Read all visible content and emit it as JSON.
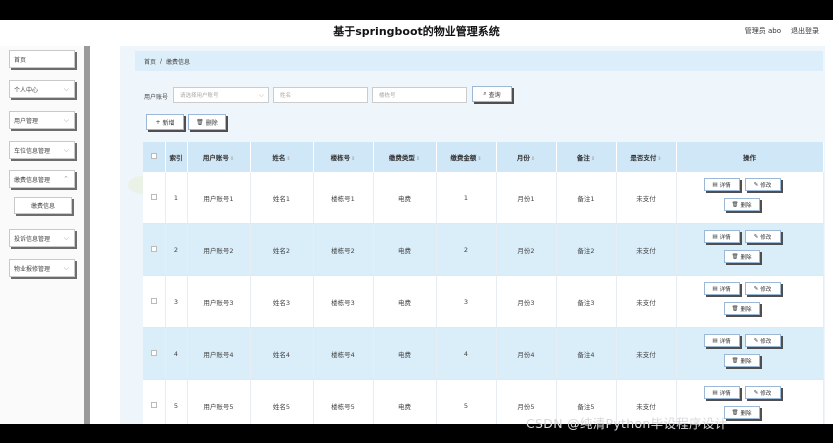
{
  "header": {
    "title": "基于springboot的物业管理系统",
    "user": "管理员 abo",
    "logout": "退出登录"
  },
  "sidebar": {
    "items": [
      {
        "label": "首页",
        "has_chevron": false
      },
      {
        "label": "个人中心",
        "has_chevron": true
      },
      {
        "label": "用户管理",
        "has_chevron": true
      },
      {
        "label": "车位信息管理",
        "has_chevron": true
      },
      {
        "label": "缴费信息管理",
        "has_chevron": true
      },
      {
        "label": "投诉信息管理",
        "has_chevron": true
      },
      {
        "label": "物业报修管理",
        "has_chevron": true
      }
    ],
    "sub_item": "缴费信息"
  },
  "breadcrumb": {
    "home": "首页",
    "sep": "/",
    "current": "缴费信息"
  },
  "search": {
    "label": "用户账号",
    "account_placeholder": "请选择用户账号",
    "name_placeholder": "姓名",
    "building_placeholder": "楼栋号",
    "query_button": "查询"
  },
  "toolbar": {
    "add_label": "新增",
    "delete_label": "删除"
  },
  "table": {
    "headers": [
      "索引",
      "用户账号",
      "姓名",
      "楼栋号",
      "缴费类型",
      "缴费金额",
      "月份",
      "备注",
      "是否支付",
      "操作"
    ],
    "rows": [
      {
        "index": "1",
        "account": "用户账号1",
        "name": "姓名1",
        "building": "楼栋号1",
        "type": "电费",
        "amount": "1",
        "month": "月份1",
        "note": "备注1",
        "paid": "未支付"
      },
      {
        "index": "2",
        "account": "用户账号2",
        "name": "姓名2",
        "building": "楼栋号2",
        "type": "电费",
        "amount": "2",
        "month": "月份2",
        "note": "备注2",
        "paid": "未支付"
      },
      {
        "index": "3",
        "account": "用户账号3",
        "name": "姓名3",
        "building": "楼栋号3",
        "type": "电费",
        "amount": "3",
        "month": "月份3",
        "note": "备注3",
        "paid": "未支付"
      },
      {
        "index": "4",
        "account": "用户账号4",
        "name": "姓名4",
        "building": "楼栋号4",
        "type": "电费",
        "amount": "4",
        "month": "月份4",
        "note": "备注4",
        "paid": "未支付"
      },
      {
        "index": "5",
        "account": "用户账号5",
        "name": "姓名5",
        "building": "楼栋号5",
        "type": "电费",
        "amount": "5",
        "month": "月份5",
        "note": "备注5",
        "paid": "未支付"
      }
    ],
    "ops": {
      "detail": "详情",
      "edit": "修改",
      "delete": "删除"
    }
  },
  "watermark": "CSDN @纯清Python毕设程序设计",
  "colors": {
    "header_row": "#cfe7f6",
    "alt_row": "#daeefa",
    "breadcrumb_bg": "#dbeef9"
  }
}
